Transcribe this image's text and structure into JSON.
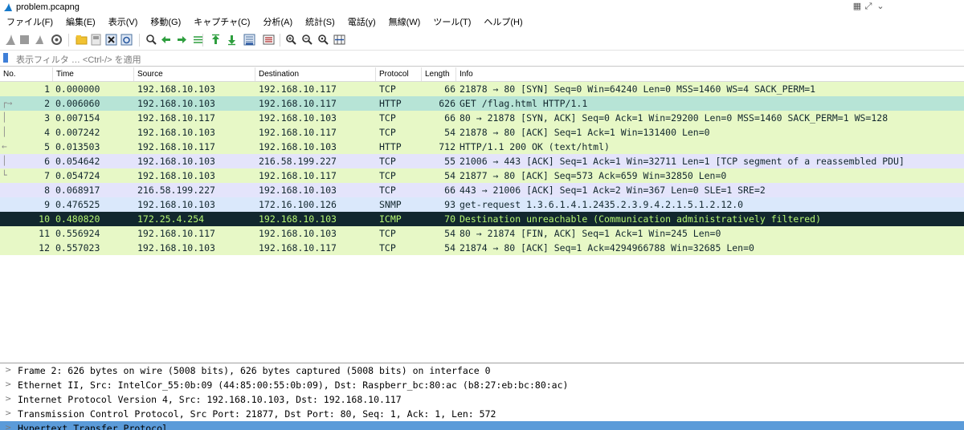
{
  "window": {
    "title": "problem.pcapng"
  },
  "menu": [
    "ファイル(F)",
    "編集(E)",
    "表示(V)",
    "移動(G)",
    "キャプチャ(C)",
    "分析(A)",
    "統計(S)",
    "電話(y)",
    "無線(W)",
    "ツール(T)",
    "ヘルプ(H)"
  ],
  "toolbar": {
    "icons": [
      "shark-fin-start-icon",
      "stop-square-icon",
      "restart-icon",
      "options-gear-icon",
      "open-folder-icon",
      "save-file-icon",
      "close-file-icon",
      "reload-icon",
      "find-icon",
      "back-arrow-icon",
      "forward-arrow-icon",
      "go-to-packet-icon",
      "first-packet-icon",
      "last-packet-icon",
      "autoscroll-icon",
      "colorize-icon",
      "zoom-in-icon",
      "zoom-out-icon",
      "zoom-reset-icon",
      "resize-columns-icon"
    ]
  },
  "filter": {
    "placeholder": "表示フィルタ … <Ctrl-/> を適用"
  },
  "columns": [
    "No.",
    "Time",
    "Source",
    "Destination",
    "Protocol",
    "Length",
    "Info"
  ],
  "packets": [
    {
      "no": "1",
      "time": "0.000000",
      "src": "192.168.10.103",
      "dst": "192.168.10.117",
      "proto": "TCP",
      "len": "66",
      "info": "21878 → 80 [SYN] Seq=0 Win=64240 Len=0 MSS=1460 WS=4 SACK_PERM=1",
      "bg": "#e7f8c6",
      "mark": ""
    },
    {
      "no": "2",
      "time": "0.006060",
      "src": "192.168.10.103",
      "dst": "192.168.10.117",
      "proto": "HTTP",
      "len": "626",
      "info": "GET /flag.html HTTP/1.1",
      "bg": "#b7e4d6",
      "mark": "┌→"
    },
    {
      "no": "3",
      "time": "0.007154",
      "src": "192.168.10.117",
      "dst": "192.168.10.103",
      "proto": "TCP",
      "len": "66",
      "info": "80 → 21878 [SYN, ACK] Seq=0 Ack=1 Win=29200 Len=0 MSS=1460 SACK_PERM=1 WS=128",
      "bg": "#e7f8c6",
      "mark": "│"
    },
    {
      "no": "4",
      "time": "0.007242",
      "src": "192.168.10.103",
      "dst": "192.168.10.117",
      "proto": "TCP",
      "len": "54",
      "info": "21878 → 80 [ACK] Seq=1 Ack=1 Win=131400 Len=0",
      "bg": "#e7f8c6",
      "mark": "│"
    },
    {
      "no": "5",
      "time": "0.013503",
      "src": "192.168.10.117",
      "dst": "192.168.10.103",
      "proto": "HTTP",
      "len": "712",
      "info": "HTTP/1.1 200 OK  (text/html)",
      "bg": "#e7f8c6",
      "mark": "←"
    },
    {
      "no": "6",
      "time": "0.054642",
      "src": "192.168.10.103",
      "dst": "216.58.199.227",
      "proto": "TCP",
      "len": "55",
      "info": "21006 → 443 [ACK] Seq=1 Ack=1 Win=32711 Len=1 [TCP segment of a reassembled PDU]",
      "bg": "#e4e4fb",
      "mark": "│"
    },
    {
      "no": "7",
      "time": "0.054724",
      "src": "192.168.10.103",
      "dst": "192.168.10.117",
      "proto": "TCP",
      "len": "54",
      "info": "21877 → 80 [ACK] Seq=573 Ack=659 Win=32850 Len=0",
      "bg": "#e7f8c6",
      "mark": "└"
    },
    {
      "no": "8",
      "time": "0.068917",
      "src": "216.58.199.227",
      "dst": "192.168.10.103",
      "proto": "TCP",
      "len": "66",
      "info": "443 → 21006 [ACK] Seq=1 Ack=2 Win=367 Len=0 SLE=1 SRE=2",
      "bg": "#e4e4fb",
      "mark": ""
    },
    {
      "no": "9",
      "time": "0.476525",
      "src": "192.168.10.103",
      "dst": "172.16.100.126",
      "proto": "SNMP",
      "len": "93",
      "info": "get-request 1.3.6.1.4.1.2435.2.3.9.4.2.1.5.1.2.12.0",
      "bg": "#dae8fb",
      "mark": ""
    },
    {
      "no": "10",
      "time": "0.480820",
      "src": "172.25.4.254",
      "dst": "192.168.10.103",
      "proto": "ICMP",
      "len": "70",
      "info": "Destination unreachable (Communication administratively filtered)",
      "bg": "#12272e",
      "mark": ""
    },
    {
      "no": "11",
      "time": "0.556924",
      "src": "192.168.10.117",
      "dst": "192.168.10.103",
      "proto": "TCP",
      "len": "54",
      "info": "80 → 21874 [FIN, ACK] Seq=1 Ack=1 Win=245 Len=0",
      "bg": "#e7f8c6",
      "mark": ""
    },
    {
      "no": "12",
      "time": "0.557023",
      "src": "192.168.10.103",
      "dst": "192.168.10.117",
      "proto": "TCP",
      "len": "54",
      "info": "21874 → 80 [ACK] Seq=1 Ack=4294966788 Win=32685 Len=0",
      "bg": "#e7f8c6",
      "mark": ""
    }
  ],
  "details": [
    {
      "text": "Frame 2: 626 bytes on wire (5008 bits), 626 bytes captured (5008 bits) on interface 0",
      "selected": false
    },
    {
      "text": "Ethernet II, Src: IntelCor_55:0b:09 (44:85:00:55:0b:09), Dst: Raspberr_bc:80:ac (b8:27:eb:bc:80:ac)",
      "selected": false
    },
    {
      "text": "Internet Protocol Version 4, Src: 192.168.10.103, Dst: 192.168.10.117",
      "selected": false
    },
    {
      "text": "Transmission Control Protocol, Src Port: 21877, Dst Port: 80, Seq: 1, Ack: 1, Len: 572",
      "selected": false
    },
    {
      "text": "Hypertext Transfer Protocol",
      "selected": true
    }
  ],
  "colors": {
    "icmp_row_fg": "#b7f774",
    "selection": "#5b9bd9"
  }
}
